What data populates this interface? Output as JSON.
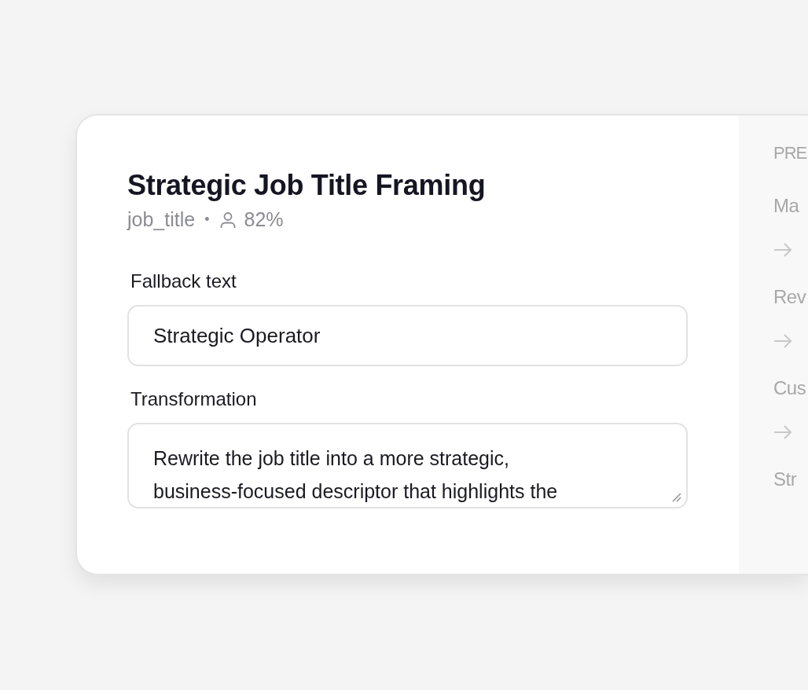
{
  "card": {
    "title": "Strategic Job Title Framing",
    "meta": {
      "field": "job_title",
      "separator": "•",
      "match": "82%"
    },
    "fields": [
      {
        "label": "Fallback text",
        "kind": "input",
        "value": "Strategic Operator"
      },
      {
        "label": "Transformation",
        "kind": "textarea",
        "value": "Rewrite the job title into a more strategic, business-focused descriptor that highlights the"
      }
    ]
  },
  "preview": {
    "heading": "PRE",
    "entries": [
      {
        "kind": "label",
        "text": "Ma"
      },
      {
        "kind": "arrow"
      },
      {
        "kind": "label",
        "text": "Rev"
      },
      {
        "kind": "arrow"
      },
      {
        "kind": "label",
        "text": "Cus"
      },
      {
        "kind": "arrow"
      },
      {
        "kind": "label",
        "text": "Str"
      }
    ]
  }
}
